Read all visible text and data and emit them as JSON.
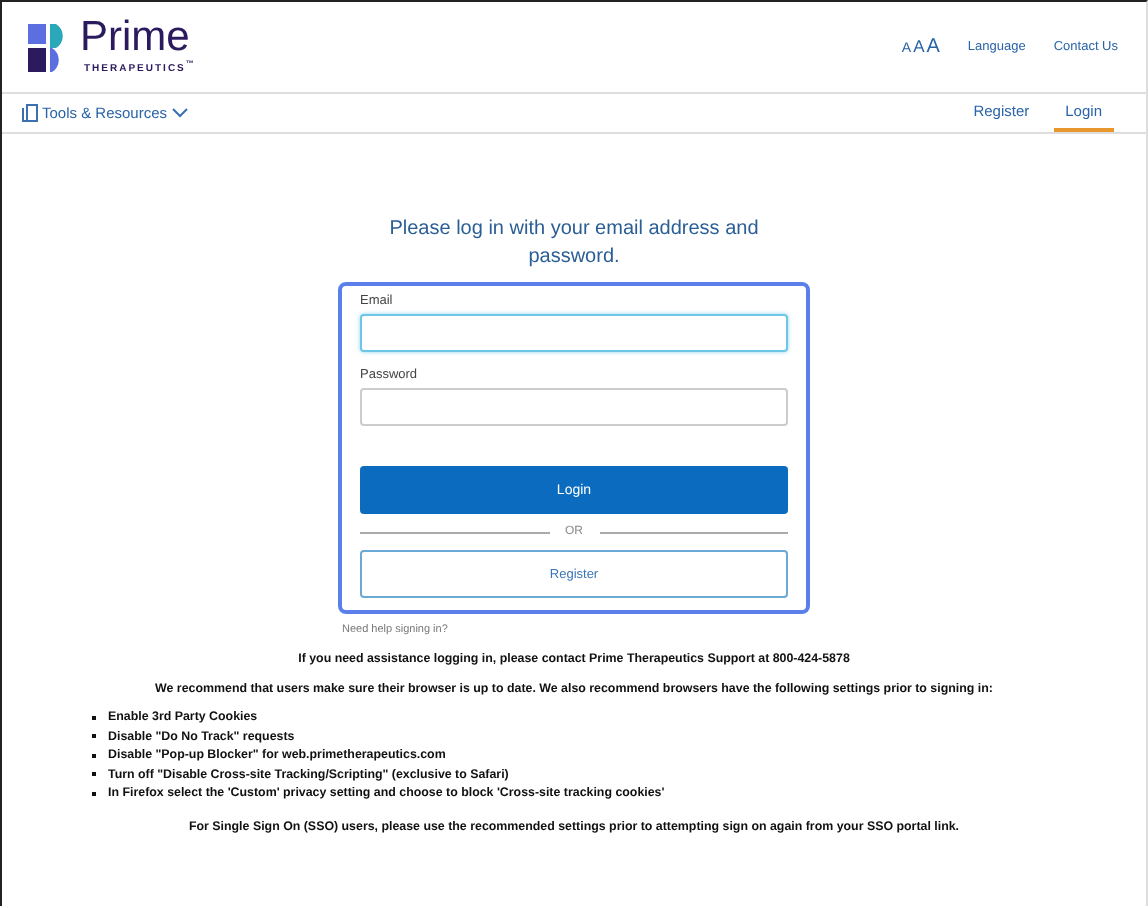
{
  "header": {
    "logo_name": "Prime",
    "logo_tagline": "THERAPEUTICS",
    "logo_mark": "™",
    "font_size_control": [
      "A",
      "A",
      "A"
    ],
    "links": [
      "Language",
      "Contact Us"
    ]
  },
  "nav": {
    "menu": "Tools & Resources",
    "tabs": [
      {
        "label": "Register",
        "selected": false
      },
      {
        "label": "Login",
        "selected": true
      }
    ]
  },
  "login": {
    "heading": "Please log in with your email address and password.",
    "fields": [
      {
        "label": "Email",
        "focused": true
      },
      {
        "label": "Password",
        "focused": false
      }
    ],
    "login_button": "Login",
    "divider": "OR",
    "register_button": "Register",
    "help_link": "Need help signing in?"
  },
  "info": {
    "support": "If you need assistance logging in, please contact Prime Therapeutics Support at 800-424-5878",
    "recommend": "We recommend that users make sure their browser is up to date. We also recommend browsers have the following settings prior to signing in:",
    "settings": [
      "Enable 3rd Party Cookies",
      "Disable \"Do No Track\" requests",
      "Disable \"Pop-up Blocker\" for web.primetherapeutics.com",
      "Turn off \"Disable Cross-site Tracking/Scripting\" (exclusive to Safari)",
      "In Firefox select the 'Custom' privacy setting and choose to block 'Cross-site tracking cookies'"
    ],
    "sso": "For Single Sign On (SSO) users, please use the recommended settings prior to attempting sign on again from your SSO portal link."
  }
}
